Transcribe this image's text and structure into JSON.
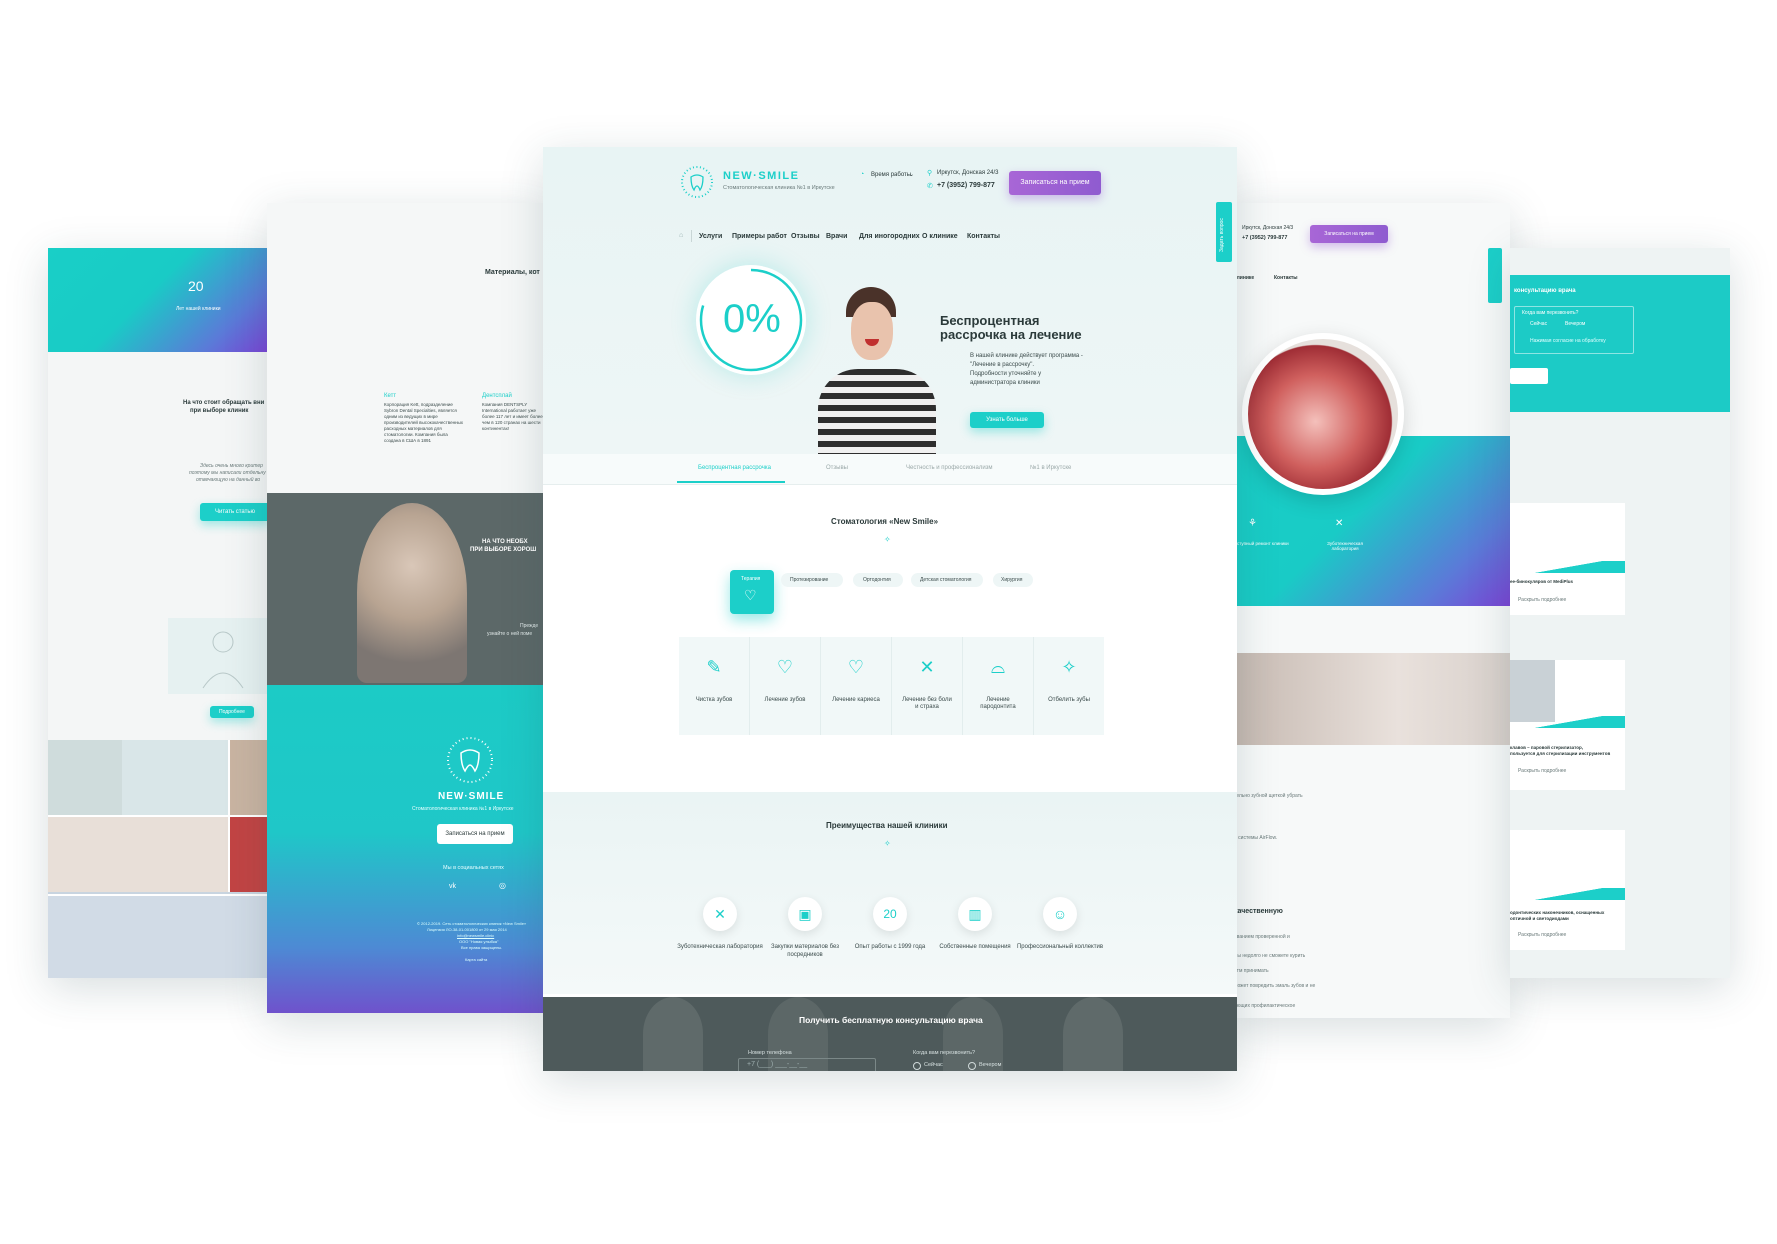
{
  "brand": {
    "name": "NEW·SMILE",
    "tagline": "Стоматологическая клиника №1 в Иркутске"
  },
  "colors": {
    "teal": "#1ccfc9",
    "purple": "#9a5fd4",
    "dark": "#4a5859"
  },
  "header": {
    "hours_label": "Время работы",
    "address": "Иркутск, Донская 24/3",
    "phone": "+7 (3952) 799-877",
    "cta": "Записаться на прием"
  },
  "nav": [
    "Услуги",
    "Примеры работ",
    "Отзывы",
    "Врачи",
    "Для иногородних",
    "О клинике",
    "Контакты"
  ],
  "side_tab": "Задать вопрос",
  "hero": {
    "percent": "0%",
    "title_line1": "Беспроцентная",
    "title_line2": "рассрочка на лечение",
    "text_line1": "В нашей клинике действует программа -",
    "text_line2": "\"Лечение в рассрочку\".",
    "text_line3": "Подробности уточняйте у",
    "text_line4": "администратора клиники",
    "button": "Узнать больше"
  },
  "tabs": [
    "Беспроцентная рассрочка",
    "Отзывы",
    "Честность и профессионализм",
    "№1 в Иркутске"
  ],
  "clinic": {
    "title": "Стоматология «New Smile»",
    "categories": [
      "Терапия",
      "Протезирование",
      "Ортодонтия",
      "Детская стоматология",
      "Хирургия"
    ],
    "services": [
      "Чистка зубов",
      "Лечение зубов",
      "Лечение кариеса",
      "Лечение без боли и страха",
      "Лечение пародонтита",
      "Отбелить зубы"
    ]
  },
  "advantages": {
    "title": "Преимущества нашей клиники",
    "items": [
      "Зуботехническая лаборатория",
      "Закупки материалов без посредников",
      "Опыт работы с 1999 года",
      "Собственные помещения",
      "Профессиональный коллектив"
    ],
    "badge": "20"
  },
  "consult": {
    "title": "Получить бесплатную консультацию врача",
    "phone_label": "Номер телефона",
    "phone_placeholder": "+7 (___) ___-__-__",
    "when_label": "Когда вам перезвонить?",
    "opt1": "Сейчас",
    "opt2": "Вечером"
  },
  "left_page": {
    "stat_num": "20",
    "stat_label": "Лет нашей клиники",
    "heading_line1": "На что стоит обращать вни",
    "heading_line2": "при выборе клиник",
    "text_line1": "Здесь очень много критер",
    "text_line2": "поэтому мы написали отдельну",
    "text_line3": "отвечающую на данный во",
    "read_btn": "Читать статью",
    "more_btn": "Подробнее"
  },
  "second_page": {
    "heading": "Материалы, кот",
    "col1_title": "Кетт",
    "col1_text": "Корпорация Kett, подразделение Sybron Dental Specialties, является одним из ведущих в мире производителей высококачественных расходных материалов для стоматологии. Компания была создана в США в 1891",
    "col2_title": "Дентсплай",
    "col2_text": "Компания DENTSPLY International работает уже более 117 лет и имеет более чем в 120 странах на шести континентах!",
    "overlay_line1": "НА ЧТО НЕОБХ",
    "overlay_line2": "ПРИ ВЫБОРЕ ХОРОШ",
    "overlay_text": "Прежде",
    "overlay_text2": "узнайте о ней поме",
    "footer_btn": "Записаться на прием",
    "social": "Мы в социальных сетях",
    "copyright": "© 2012-2019. Сеть стоматологических клиник «New Smile»",
    "license": "Лицензия ЛО-38-01-001800 от 29 мая 2014",
    "email": "info@newsmile.clinic",
    "ooo": "ООО \"Новая улыбка\"",
    "rights": "Все права защищены.",
    "sitemap": "Карта сайта"
  },
  "right_page": {
    "address": "Иркутск, Донская 24/3",
    "phone": "+7 (3952) 799-877",
    "cta": "Записаться на прием",
    "nav_tail1": "клинике",
    "nav_tail2": "Контакты",
    "feat1": "Доступный ремонт клиники",
    "feat2": "Зуботехническая лаборатория",
    "text1": "тельно зубной щеткой убрать",
    "text2": "о системы AirFlow.",
    "heading": "качественную",
    "line1": "ованием проверенной и",
    "line2": "Вы недолго не сможете курить",
    "line3": "атм принимать",
    "line4": "может повредить эмаль зубов и не",
    "line5": "ающих профилактическое"
  },
  "far_right": {
    "title": "консультацию врача",
    "label": "Когда вам перезвонить?",
    "opt1": "Сейчас",
    "opt2": "Вечером",
    "note": "Нажимая согласие на обработку",
    "item1": "ее-бинокуляров от MediPlus",
    "link": "Раскрыть подробнее",
    "item2_line1": "клавов – паровой стерилизатор,",
    "item2_line2": "пользуется для стерилизации инструментов",
    "item3_line1": "одонтических наконечников, оснащенных",
    "item3_line2": "оптичной и светодиодами"
  }
}
